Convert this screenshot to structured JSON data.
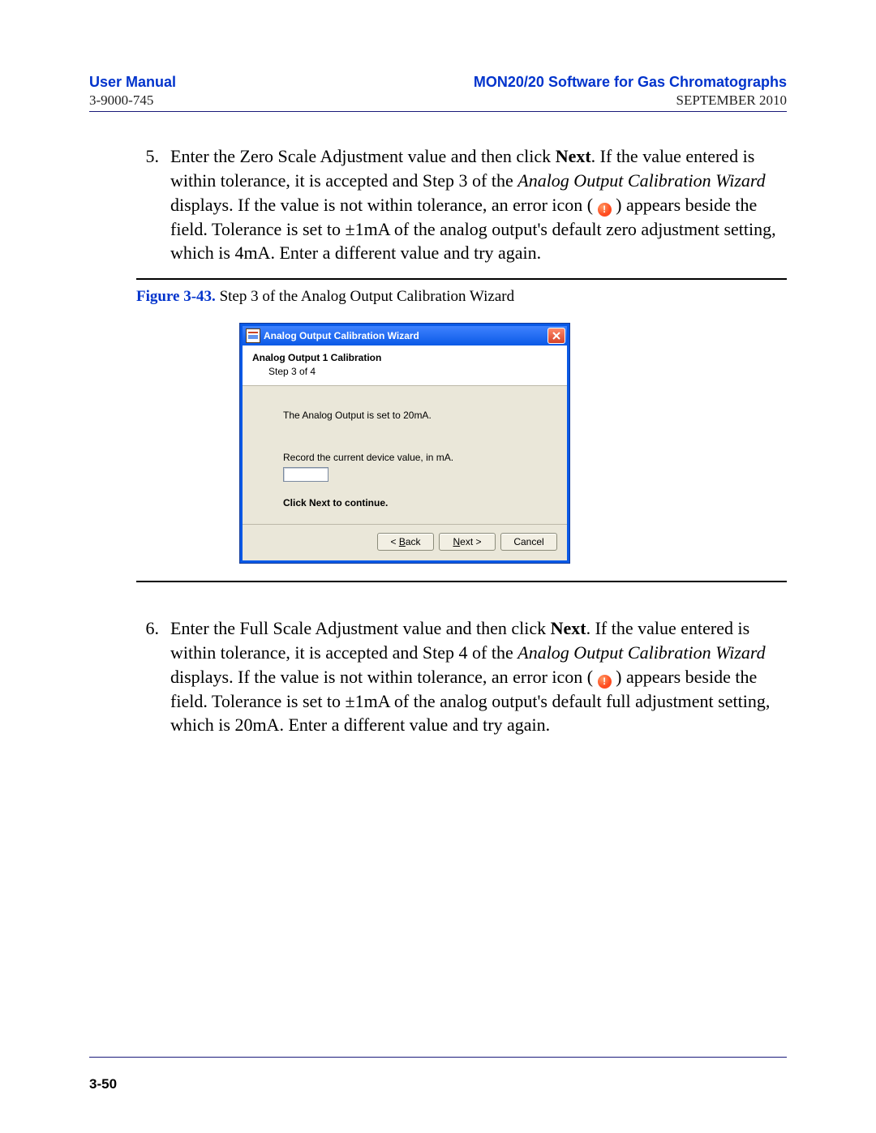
{
  "header": {
    "manual_title": "User Manual",
    "doc_number": "3-9000-745",
    "product_title": "MON20/20 Software for Gas Chromatographs",
    "doc_date": "SEPTEMBER 2010"
  },
  "step5": {
    "num": "5.",
    "part1_a": "Enter the Zero Scale Adjustment value and then click ",
    "next_word": "Next",
    "part1_b": ".  If the value entered is within tolerance, it is accepted and Step 3 of the ",
    "wizard_name": "Analog Output Calibration Wizard",
    "part1_c": " displays.  If the value is not within tolerance, an error icon ( ",
    "part2": " ) appears beside the field.  Tolerance is set to ±1mA of the analog output's default zero adjustment setting, which is 4mA.  Enter a different value and try again."
  },
  "figure": {
    "label": "Figure 3-43.",
    "caption": "  Step 3 of the Analog Output Calibration Wizard"
  },
  "wizard": {
    "title": "Analog Output Calibration Wizard",
    "header_title": "Analog Output 1 Calibration",
    "header_step": "Step 3 of 4",
    "msg1": "The Analog Output is set to 20mA.",
    "msg2": "Record the current device value, in mA.",
    "input_value": "",
    "msg3": "Click Next to continue.",
    "back_prefix": "< ",
    "back_u": "B",
    "back_rest": "ack",
    "next_u": "N",
    "next_rest": "ext >",
    "cancel": "Cancel"
  },
  "step6": {
    "num": "6.",
    "part1_a": "Enter the Full Scale Adjustment value and then click ",
    "next_word": "Next",
    "part1_b": ".  If the value entered is within tolerance, it is accepted and Step 4 of the ",
    "wizard_name": "Analog Output Calibration Wizard",
    "part1_c": " displays.  If the value is not within tolerance, an error icon ( ",
    "part2": " ) appears beside the field.  Tolerance is set to ±1mA of the analog output's default full adjustment setting, which is 20mA.  Enter a different value and try again."
  },
  "page_number": "3-50"
}
